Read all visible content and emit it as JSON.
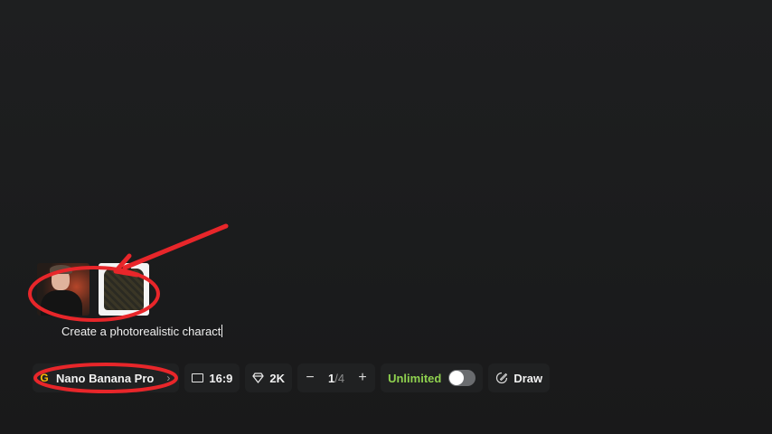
{
  "attachments": [
    {
      "name": "portrait-reference"
    },
    {
      "name": "jacket-reference"
    }
  ],
  "prompt": {
    "value": "Create a photorealistic charact"
  },
  "toolbar": {
    "model": {
      "icon": "google-icon",
      "icon_glyph": "G",
      "label": "Nano Banana Pro",
      "chevron": "›"
    },
    "aspect_ratio": {
      "icon": "aspect-ratio-icon",
      "label": "16:9"
    },
    "resolution": {
      "icon": "diamond-icon",
      "label": "2K"
    },
    "count": {
      "minus": "−",
      "current": "1",
      "total": "/4",
      "plus": "+"
    },
    "unlimited": {
      "label": "Unlimited",
      "enabled": false
    },
    "draw": {
      "icon": "draw-icon",
      "label": "Draw"
    }
  },
  "annotations": {
    "color": "#e8262a"
  }
}
